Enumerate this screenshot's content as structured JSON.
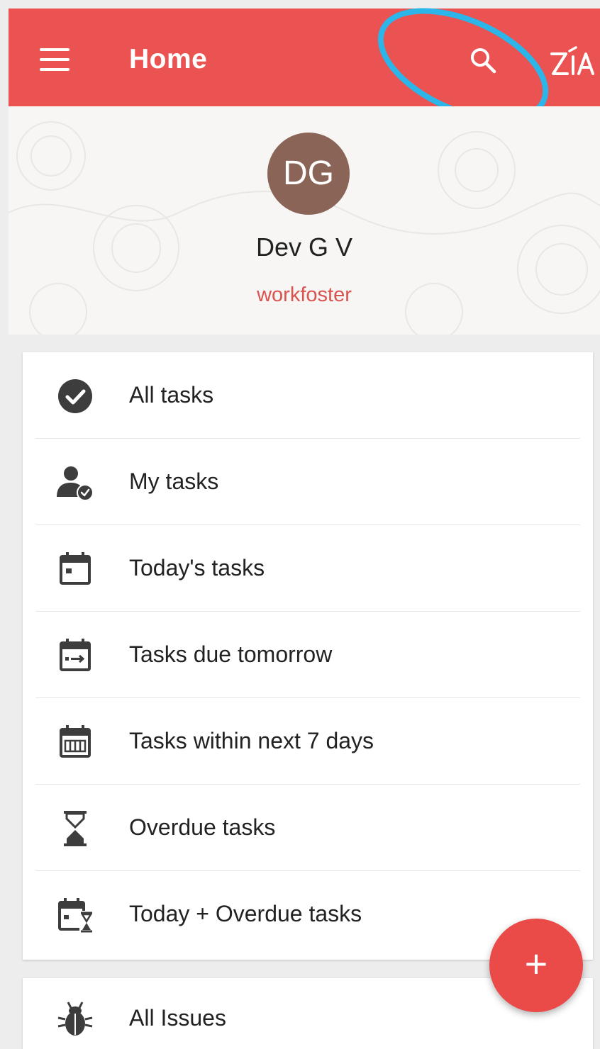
{
  "appbar": {
    "title": "Home",
    "icons": [
      "menu-icon",
      "search-icon",
      "zia-icon"
    ]
  },
  "profile": {
    "initials": "DG",
    "name": "Dev G V",
    "org": "workfoster"
  },
  "menu": {
    "items": [
      {
        "label": "All tasks",
        "icon": "check-circle-icon"
      },
      {
        "label": "My tasks",
        "icon": "user-check-icon"
      },
      {
        "label": "Today's tasks",
        "icon": "calendar-today-icon"
      },
      {
        "label": "Tasks due tomorrow",
        "icon": "calendar-arrow-icon"
      },
      {
        "label": "Tasks within next 7 days",
        "icon": "calendar-week-icon"
      },
      {
        "label": "Overdue tasks",
        "icon": "hourglass-icon"
      },
      {
        "label": "Today + Overdue tasks",
        "icon": "calendar-hourglass-icon"
      }
    ]
  },
  "issues": {
    "label": "All Issues",
    "icon": "bug-icon"
  },
  "fab": {
    "symbol": "+"
  },
  "colors": {
    "primary": "#ea5352",
    "avatar": "#8a6457",
    "org_text": "#d9534f",
    "highlight": "#2bb5e8"
  }
}
